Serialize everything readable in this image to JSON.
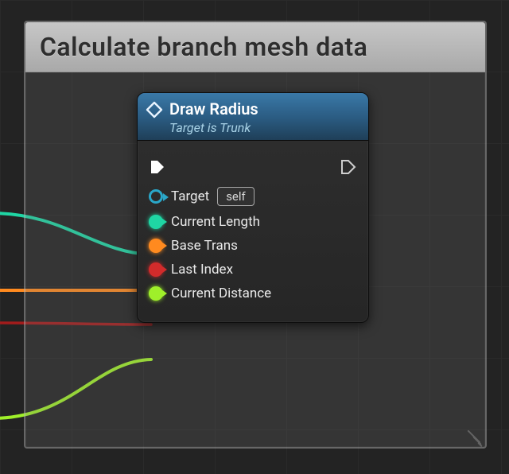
{
  "comment": {
    "title": "Calculate branch mesh data"
  },
  "node": {
    "title": "Draw Radius",
    "subtitle": "Target is Trunk",
    "pins": {
      "target": {
        "label": "Target",
        "default": "self",
        "color": "#2aa7c9"
      },
      "current_length": {
        "label": "Current Length",
        "color": "#1fd6a4"
      },
      "base_trans": {
        "label": "Base Trans",
        "color": "#ff8a1f"
      },
      "last_index": {
        "label": "Last Index",
        "color": "#d22b2b"
      },
      "current_distance": {
        "label": "Current Distance",
        "color": "#9fef2a"
      }
    }
  }
}
